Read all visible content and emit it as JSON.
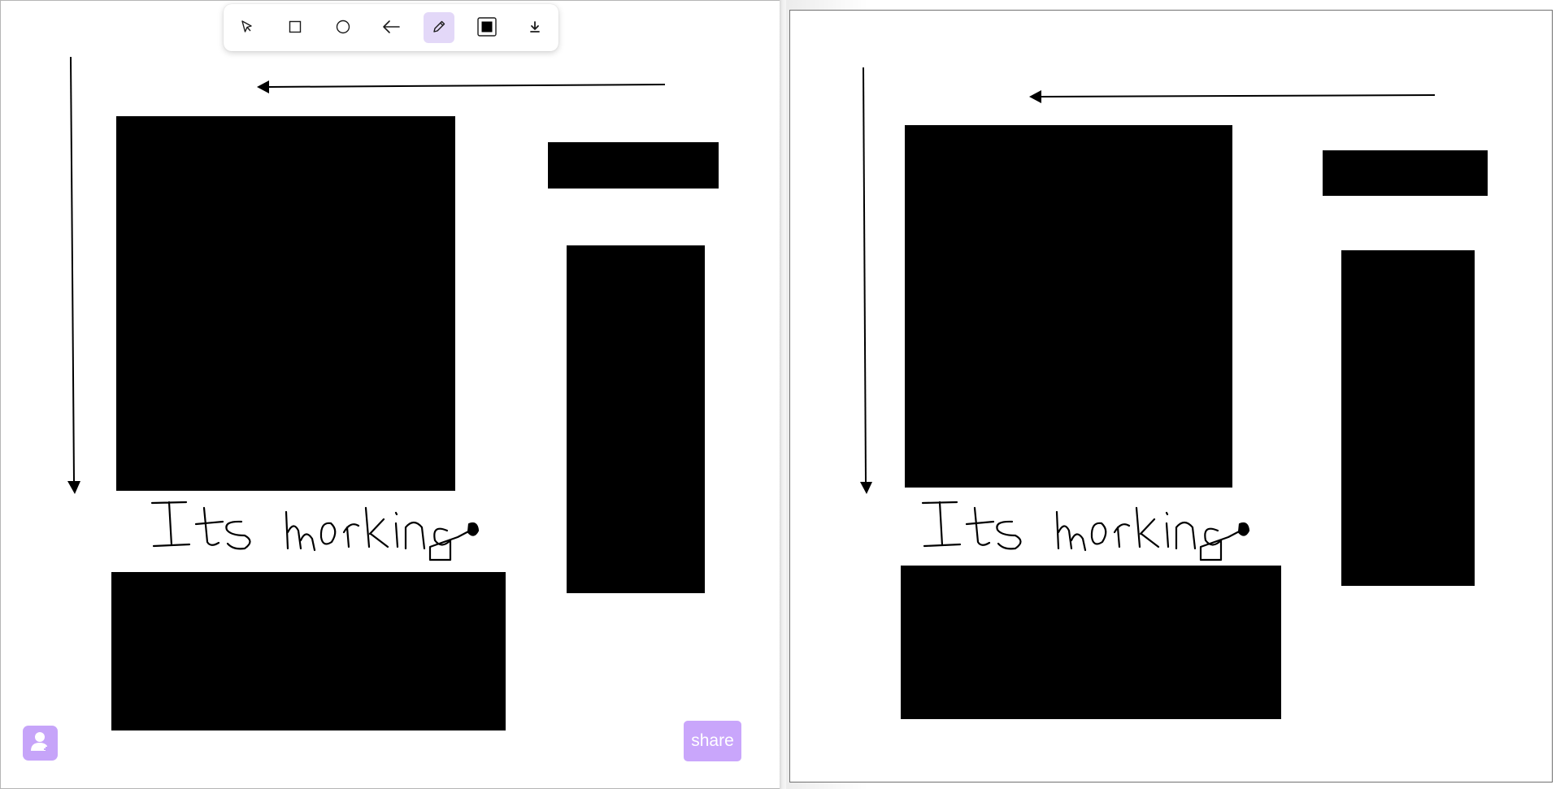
{
  "toolbar": {
    "tools": [
      {
        "id": "select",
        "icon": "cursor-icon"
      },
      {
        "id": "rectangle",
        "icon": "square-icon"
      },
      {
        "id": "circle",
        "icon": "circle-icon"
      },
      {
        "id": "arrow",
        "icon": "arrow-left-icon"
      },
      {
        "id": "pencil",
        "icon": "pencil-icon",
        "active": true
      },
      {
        "id": "fill",
        "icon": "filled-square-icon"
      },
      {
        "id": "download",
        "icon": "download-icon"
      }
    ]
  },
  "share_button": {
    "label": "share"
  },
  "user_button": {
    "icon": "person-add-icon"
  },
  "canvas": {
    "handwriting": "Its Working",
    "shape_fill": "#000000",
    "stroke_color": "#000000"
  },
  "colors": {
    "accent": "#c9a6fb",
    "active_tool_bg": "#e3d8f8",
    "canvas_bg": "#ffffff"
  }
}
